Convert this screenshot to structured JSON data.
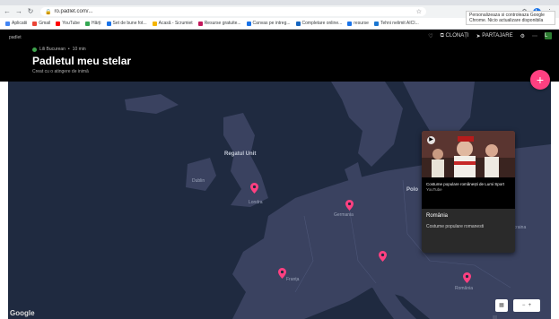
{
  "browser": {
    "url": "ro.padlet.com/...",
    "tooltip": "Personalizeaza si controleaza Google Chrome. Nicio actualizare disponibila"
  },
  "bookmarks": [
    {
      "label": "Aplicatii",
      "color": "#4285f4"
    },
    {
      "label": "Gmail",
      "color": "#ea4335"
    },
    {
      "label": "YouTube",
      "color": "#ff0000"
    },
    {
      "label": "Hărți",
      "color": "#34a853"
    },
    {
      "label": "Set de bune fot...",
      "color": "#1a73e8"
    },
    {
      "label": "Acasă - Scrumiet",
      "color": "#f4b400"
    },
    {
      "label": "Resurse gratuite...",
      "color": "#c2185b"
    },
    {
      "label": "Canvas pe intreg...",
      "color": "#1a73e8"
    },
    {
      "label": "Completare online...",
      "color": "#1565c0"
    },
    {
      "label": "resurse",
      "color": "#1a73e8"
    },
    {
      "label": "Tehni nelimit AICI...",
      "color": "#1976d2"
    }
  ],
  "padlet": {
    "brand": "padlet",
    "author": "Lili Bucurean",
    "age": "10 min",
    "title": "Padletul meu stelar",
    "subtitle": "Creat cu o atingere de inimă",
    "actions": {
      "share": "CLONAȚI",
      "post": "PARTAJARE"
    }
  },
  "map": {
    "labels": [
      {
        "text": "Regatul Unit",
        "big": true
      },
      {
        "text": "Dublin",
        "big": false
      },
      {
        "text": "Londra",
        "big": false
      },
      {
        "text": "Germania",
        "big": false
      },
      {
        "text": "Franța",
        "big": false
      },
      {
        "text": "România",
        "big": false
      },
      {
        "text": "Polo",
        "big": false
      },
      {
        "text": "Ucraina",
        "big": false
      }
    ],
    "google": "Google"
  },
  "card": {
    "video_title": "Costume populare românești de Lumi Sport",
    "video_source": "YouTube",
    "title": "România",
    "text": "Costume populare romanesti"
  },
  "colors": {
    "accent": "#ff4081",
    "map_bg": "#1f2a40",
    "land": "#3a4260"
  }
}
